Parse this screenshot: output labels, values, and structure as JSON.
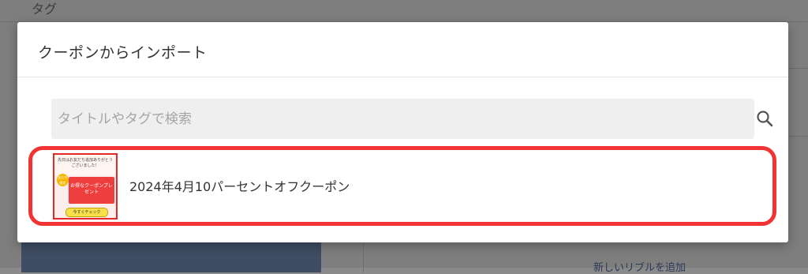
{
  "background": {
    "tag_label": "タグ",
    "add_link": "新しいリブルを追加"
  },
  "modal": {
    "title": "クーポンからインポート",
    "search": {
      "placeholder": "タイトルやタグで検索",
      "value": "",
      "icon": "search-icon"
    },
    "items": [
      {
        "label": "2024年4月10パーセントオフクーポン",
        "thumbnail": {
          "heading": "先日はお友だち追加ありがとうございました！",
          "badge": "友だち限定",
          "card_title": "お得なクーポンプレゼント",
          "button": "今すぐチェック"
        }
      }
    ]
  },
  "colors": {
    "highlight": "#f23333",
    "overlay": "#7e7e7e"
  }
}
